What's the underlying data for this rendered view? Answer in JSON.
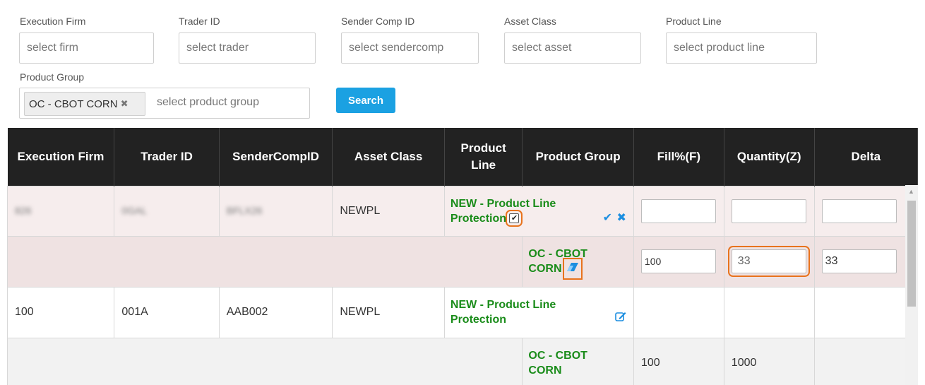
{
  "filters": {
    "execution_firm": {
      "label": "Execution Firm",
      "placeholder": "select firm"
    },
    "trader_id": {
      "label": "Trader ID",
      "placeholder": "select trader"
    },
    "sender_comp_id": {
      "label": "Sender Comp ID",
      "placeholder": "select sendercomp"
    },
    "asset_class": {
      "label": "Asset Class",
      "placeholder": "select asset"
    },
    "product_line": {
      "label": "Product Line",
      "placeholder": "select product line"
    },
    "product_group": {
      "label": "Product Group",
      "chip": "OC - CBOT CORN",
      "chip_remove": "✖",
      "placeholder": "select product group"
    },
    "search_label": "Search"
  },
  "table": {
    "headers": {
      "execution_firm": "Execution Firm",
      "trader_id": "Trader ID",
      "sendercompid": "SenderCompID",
      "asset_class": "Asset Class",
      "product_line": "Product Line",
      "product_group": "Product Group",
      "fill": "Fill%(F)",
      "quantity": "Quantity(Z)",
      "delta": "Delta"
    },
    "rows": [
      {
        "execution_firm": "826",
        "trader_id": "0GAL",
        "sendercompid": "BFLX26",
        "asset_class": "NEWPL",
        "product_line": "NEW - Product Line Protection",
        "checkbox": "✔",
        "confirm": "✔",
        "cancel": "✖"
      },
      {
        "product_group": "OC - CBOT CORN",
        "fill": "100",
        "quantity": "33",
        "delta": "33"
      },
      {
        "execution_firm": "100",
        "trader_id": "001A",
        "sendercompid": "AAB002",
        "asset_class": "NEWPL",
        "product_line": "NEW - Product Line Protection"
      },
      {
        "product_group": "OC - CBOT CORN",
        "fill": "100",
        "quantity": "1000"
      }
    ]
  },
  "colors": {
    "header_bg": "#222222",
    "accent": "#1ba1e2",
    "highlight": "#e8731d",
    "green_text": "#1a8c1a"
  }
}
